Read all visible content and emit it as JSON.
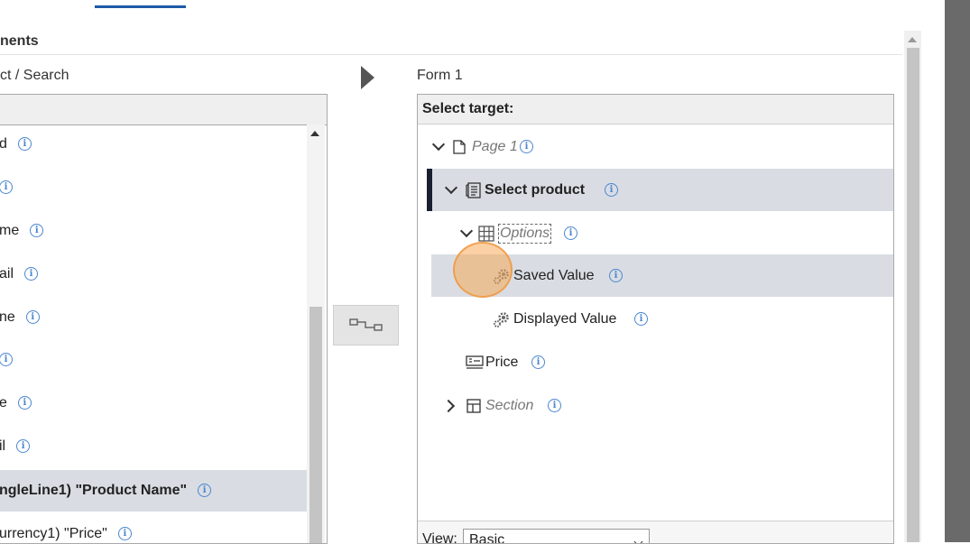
{
  "header": {
    "section_title": "nents",
    "source_label": "ct / Search",
    "target_form_label": "Form 1"
  },
  "left_list": [
    {
      "text": "d",
      "selected": false
    },
    {
      "text": "",
      "selected": false
    },
    {
      "text": "me",
      "selected": false
    },
    {
      "text": "ail",
      "selected": false
    },
    {
      "text": "ne",
      "selected": false
    },
    {
      "text": "",
      "selected": false
    },
    {
      "text": "e",
      "selected": false
    },
    {
      "text": "il",
      "selected": false
    },
    {
      "text": "ngleLine1) \"Product Name\"",
      "selected": true
    },
    {
      "text": "urrency1) \"Price\"",
      "selected": false
    }
  ],
  "target_panel": {
    "heading": "Select target:",
    "tree": {
      "page": "Page 1",
      "select_product": "Select product",
      "options": "Options",
      "saved_value": "Saved Value",
      "displayed_value": "Displayed Value",
      "price": "Price",
      "section": "Section"
    },
    "view_label": "View:",
    "view_value": "Basic"
  },
  "icons": {
    "info": "info-icon",
    "page": "page-icon",
    "form": "form-icon",
    "grid": "grid-icon",
    "gear": "gear-icon",
    "field": "field-icon",
    "section": "section-icon",
    "map": "map-connect-icon"
  },
  "colors": {
    "accent": "#1f5aa6",
    "selected_row": "#d9dde3",
    "info": "#4a86cf"
  }
}
